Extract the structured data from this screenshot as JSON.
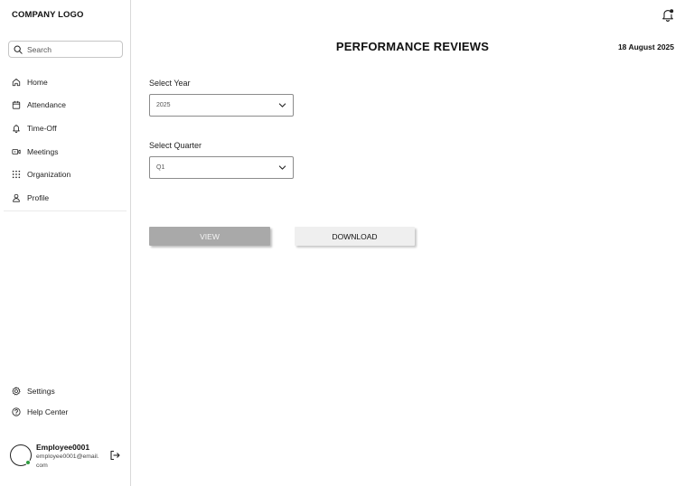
{
  "sidebar": {
    "logo": "COMPANY LOGO",
    "search": {
      "placeholder": "Search"
    },
    "items": [
      {
        "label": "Home",
        "icon": "home-icon"
      },
      {
        "label": "Attendance",
        "icon": "calendar-icon"
      },
      {
        "label": "Time-Off",
        "icon": "bell-icon"
      },
      {
        "label": "Meetings",
        "icon": "video-icon"
      },
      {
        "label": "Organization",
        "icon": "grid-icon"
      },
      {
        "label": "Profile",
        "icon": "user-icon"
      }
    ],
    "bottom_items": [
      {
        "label": "Settings",
        "icon": "gear-icon"
      },
      {
        "label": "Help Center",
        "icon": "help-icon"
      }
    ],
    "user": {
      "name": "Employee0001",
      "email": "employee0001@email.com",
      "status_color": "#2e9b3f"
    }
  },
  "header": {
    "title": "PERFORMANCE REVIEWS",
    "date": "18 August 2025"
  },
  "form": {
    "year": {
      "label": "Select Year",
      "value": "2025"
    },
    "quarter": {
      "label": "Select Quarter",
      "value": "Q1"
    },
    "view_label": "VIEW",
    "download_label": "DOWNLOAD"
  }
}
